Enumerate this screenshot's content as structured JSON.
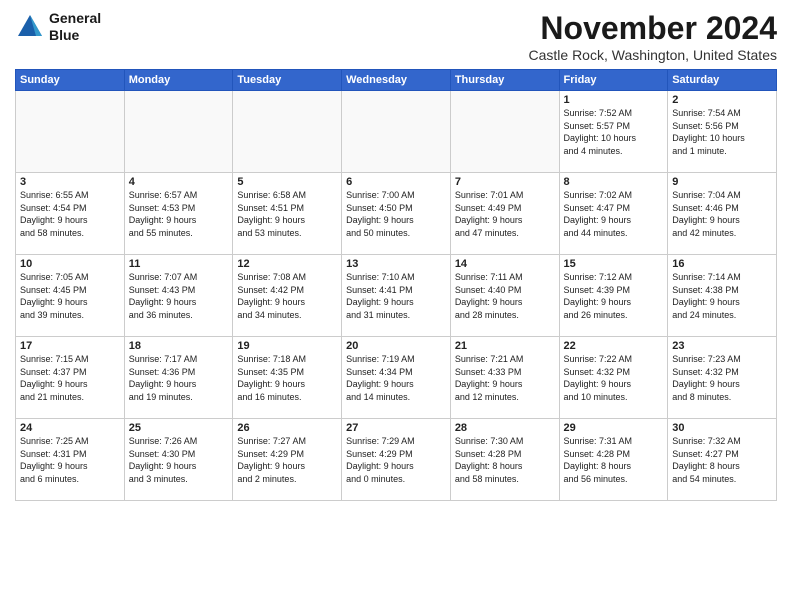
{
  "logo": {
    "line1": "General",
    "line2": "Blue"
  },
  "title": "November 2024",
  "location": "Castle Rock, Washington, United States",
  "days_of_week": [
    "Sunday",
    "Monday",
    "Tuesday",
    "Wednesday",
    "Thursday",
    "Friday",
    "Saturday"
  ],
  "weeks": [
    [
      {
        "day": "",
        "info": ""
      },
      {
        "day": "",
        "info": ""
      },
      {
        "day": "",
        "info": ""
      },
      {
        "day": "",
        "info": ""
      },
      {
        "day": "",
        "info": ""
      },
      {
        "day": "1",
        "info": "Sunrise: 7:52 AM\nSunset: 5:57 PM\nDaylight: 10 hours\nand 4 minutes."
      },
      {
        "day": "2",
        "info": "Sunrise: 7:54 AM\nSunset: 5:56 PM\nDaylight: 10 hours\nand 1 minute."
      }
    ],
    [
      {
        "day": "3",
        "info": "Sunrise: 6:55 AM\nSunset: 4:54 PM\nDaylight: 9 hours\nand 58 minutes."
      },
      {
        "day": "4",
        "info": "Sunrise: 6:57 AM\nSunset: 4:53 PM\nDaylight: 9 hours\nand 55 minutes."
      },
      {
        "day": "5",
        "info": "Sunrise: 6:58 AM\nSunset: 4:51 PM\nDaylight: 9 hours\nand 53 minutes."
      },
      {
        "day": "6",
        "info": "Sunrise: 7:00 AM\nSunset: 4:50 PM\nDaylight: 9 hours\nand 50 minutes."
      },
      {
        "day": "7",
        "info": "Sunrise: 7:01 AM\nSunset: 4:49 PM\nDaylight: 9 hours\nand 47 minutes."
      },
      {
        "day": "8",
        "info": "Sunrise: 7:02 AM\nSunset: 4:47 PM\nDaylight: 9 hours\nand 44 minutes."
      },
      {
        "day": "9",
        "info": "Sunrise: 7:04 AM\nSunset: 4:46 PM\nDaylight: 9 hours\nand 42 minutes."
      }
    ],
    [
      {
        "day": "10",
        "info": "Sunrise: 7:05 AM\nSunset: 4:45 PM\nDaylight: 9 hours\nand 39 minutes."
      },
      {
        "day": "11",
        "info": "Sunrise: 7:07 AM\nSunset: 4:43 PM\nDaylight: 9 hours\nand 36 minutes."
      },
      {
        "day": "12",
        "info": "Sunrise: 7:08 AM\nSunset: 4:42 PM\nDaylight: 9 hours\nand 34 minutes."
      },
      {
        "day": "13",
        "info": "Sunrise: 7:10 AM\nSunset: 4:41 PM\nDaylight: 9 hours\nand 31 minutes."
      },
      {
        "day": "14",
        "info": "Sunrise: 7:11 AM\nSunset: 4:40 PM\nDaylight: 9 hours\nand 28 minutes."
      },
      {
        "day": "15",
        "info": "Sunrise: 7:12 AM\nSunset: 4:39 PM\nDaylight: 9 hours\nand 26 minutes."
      },
      {
        "day": "16",
        "info": "Sunrise: 7:14 AM\nSunset: 4:38 PM\nDaylight: 9 hours\nand 24 minutes."
      }
    ],
    [
      {
        "day": "17",
        "info": "Sunrise: 7:15 AM\nSunset: 4:37 PM\nDaylight: 9 hours\nand 21 minutes."
      },
      {
        "day": "18",
        "info": "Sunrise: 7:17 AM\nSunset: 4:36 PM\nDaylight: 9 hours\nand 19 minutes."
      },
      {
        "day": "19",
        "info": "Sunrise: 7:18 AM\nSunset: 4:35 PM\nDaylight: 9 hours\nand 16 minutes."
      },
      {
        "day": "20",
        "info": "Sunrise: 7:19 AM\nSunset: 4:34 PM\nDaylight: 9 hours\nand 14 minutes."
      },
      {
        "day": "21",
        "info": "Sunrise: 7:21 AM\nSunset: 4:33 PM\nDaylight: 9 hours\nand 12 minutes."
      },
      {
        "day": "22",
        "info": "Sunrise: 7:22 AM\nSunset: 4:32 PM\nDaylight: 9 hours\nand 10 minutes."
      },
      {
        "day": "23",
        "info": "Sunrise: 7:23 AM\nSunset: 4:32 PM\nDaylight: 9 hours\nand 8 minutes."
      }
    ],
    [
      {
        "day": "24",
        "info": "Sunrise: 7:25 AM\nSunset: 4:31 PM\nDaylight: 9 hours\nand 6 minutes."
      },
      {
        "day": "25",
        "info": "Sunrise: 7:26 AM\nSunset: 4:30 PM\nDaylight: 9 hours\nand 3 minutes."
      },
      {
        "day": "26",
        "info": "Sunrise: 7:27 AM\nSunset: 4:29 PM\nDaylight: 9 hours\nand 2 minutes."
      },
      {
        "day": "27",
        "info": "Sunrise: 7:29 AM\nSunset: 4:29 PM\nDaylight: 9 hours\nand 0 minutes."
      },
      {
        "day": "28",
        "info": "Sunrise: 7:30 AM\nSunset: 4:28 PM\nDaylight: 8 hours\nand 58 minutes."
      },
      {
        "day": "29",
        "info": "Sunrise: 7:31 AM\nSunset: 4:28 PM\nDaylight: 8 hours\nand 56 minutes."
      },
      {
        "day": "30",
        "info": "Sunrise: 7:32 AM\nSunset: 4:27 PM\nDaylight: 8 hours\nand 54 minutes."
      }
    ]
  ]
}
